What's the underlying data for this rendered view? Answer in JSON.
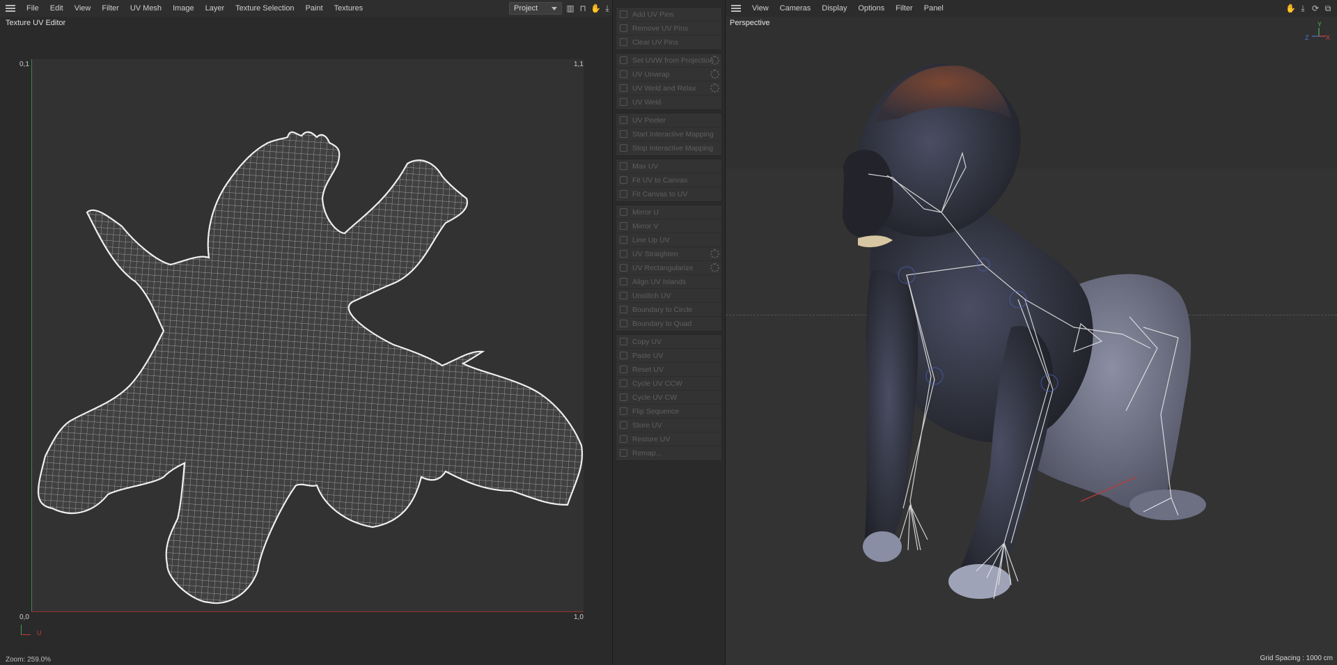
{
  "uv_editor": {
    "menu": [
      "File",
      "Edit",
      "View",
      "Filter",
      "UV Mesh",
      "Image",
      "Layer",
      "Texture Selection",
      "Paint",
      "Textures"
    ],
    "project_select": "Project",
    "title": "Texture UV Editor",
    "corners": {
      "top_left": "0,1",
      "top_right": "1,1",
      "bottom_left": "0,0",
      "bottom_right": "1,0"
    },
    "gizmo_label": "U",
    "zoom_status": "Zoom: 259.0%",
    "axis_colors": {
      "v_axis": "#3d8a4c",
      "u_axis": "#9a3434"
    }
  },
  "commands": [
    {
      "items": [
        {
          "label": "Add UV Pins",
          "icon": "pin-add-icon"
        },
        {
          "label": "Remove UV Pins",
          "icon": "pin-remove-icon"
        },
        {
          "label": "Clear UV Pins",
          "icon": "pin-clear-icon"
        }
      ]
    },
    {
      "items": [
        {
          "label": "Set UVW from Projection",
          "icon": "projection-icon",
          "gear": true
        },
        {
          "label": "UV Unwrap",
          "icon": "unwrap-icon",
          "gear": true
        },
        {
          "label": "UV Weld and Relax",
          "icon": "weld-relax-icon",
          "gear": true
        },
        {
          "label": "UV Weld",
          "icon": "weld-icon"
        }
      ]
    },
    {
      "items": [
        {
          "label": "UV Peeler",
          "icon": "peeler-icon"
        },
        {
          "label": "Start Interactive Mapping",
          "icon": "play-icon"
        },
        {
          "label": "Stop Interactive Mapping",
          "icon": "stop-icon"
        }
      ]
    },
    {
      "items": [
        {
          "label": "Max UV",
          "icon": "max-uv-icon"
        },
        {
          "label": "Fit UV to Canvas",
          "icon": "fit-uv-icon"
        },
        {
          "label": "Fit Canvas to UV",
          "icon": "fit-canvas-icon"
        }
      ]
    },
    {
      "items": [
        {
          "label": "Mirror U",
          "icon": "mirror-u-icon"
        },
        {
          "label": "Mirror V",
          "icon": "mirror-v-icon"
        },
        {
          "label": "Line Up UV",
          "icon": "line-up-icon"
        },
        {
          "label": "UV Straighten",
          "icon": "straighten-icon",
          "gear": true
        },
        {
          "label": "UV Rectangularize",
          "icon": "rectangularize-icon",
          "gear": true
        },
        {
          "label": "Align UV Islands",
          "icon": "align-icon"
        },
        {
          "label": "Unstitch UV",
          "icon": "unstitch-icon"
        },
        {
          "label": "Boundary to Circle",
          "icon": "circle-icon"
        },
        {
          "label": "Boundary to Quad",
          "icon": "quad-icon"
        }
      ]
    },
    {
      "items": [
        {
          "label": "Copy UV",
          "icon": "copy-icon"
        },
        {
          "label": "Paste UV",
          "icon": "paste-icon"
        },
        {
          "label": "Reset UV",
          "icon": "reset-icon"
        },
        {
          "label": "Cycle UV CCW",
          "icon": "rotate-ccw-icon"
        },
        {
          "label": "Cycle UV CW",
          "icon": "rotate-cw-icon"
        },
        {
          "label": "Flip Sequence",
          "icon": "flip-icon"
        },
        {
          "label": "Store UV",
          "icon": "store-icon"
        },
        {
          "label": "Restore UV",
          "icon": "restore-icon"
        },
        {
          "label": "Remap...",
          "icon": "remap-icon"
        }
      ]
    }
  ],
  "viewport": {
    "menu": [
      "View",
      "Cameras",
      "Display",
      "Options",
      "Filter",
      "Panel"
    ],
    "title": "Perspective",
    "grid_spacing": "Grid Spacing : 1000 cm",
    "gizmo": {
      "y": "Y",
      "x": "X",
      "z": "Z"
    },
    "colors": {
      "background": "#333333",
      "rig_bones": "#e6e6e6",
      "fur": "#2d2f3a"
    }
  }
}
